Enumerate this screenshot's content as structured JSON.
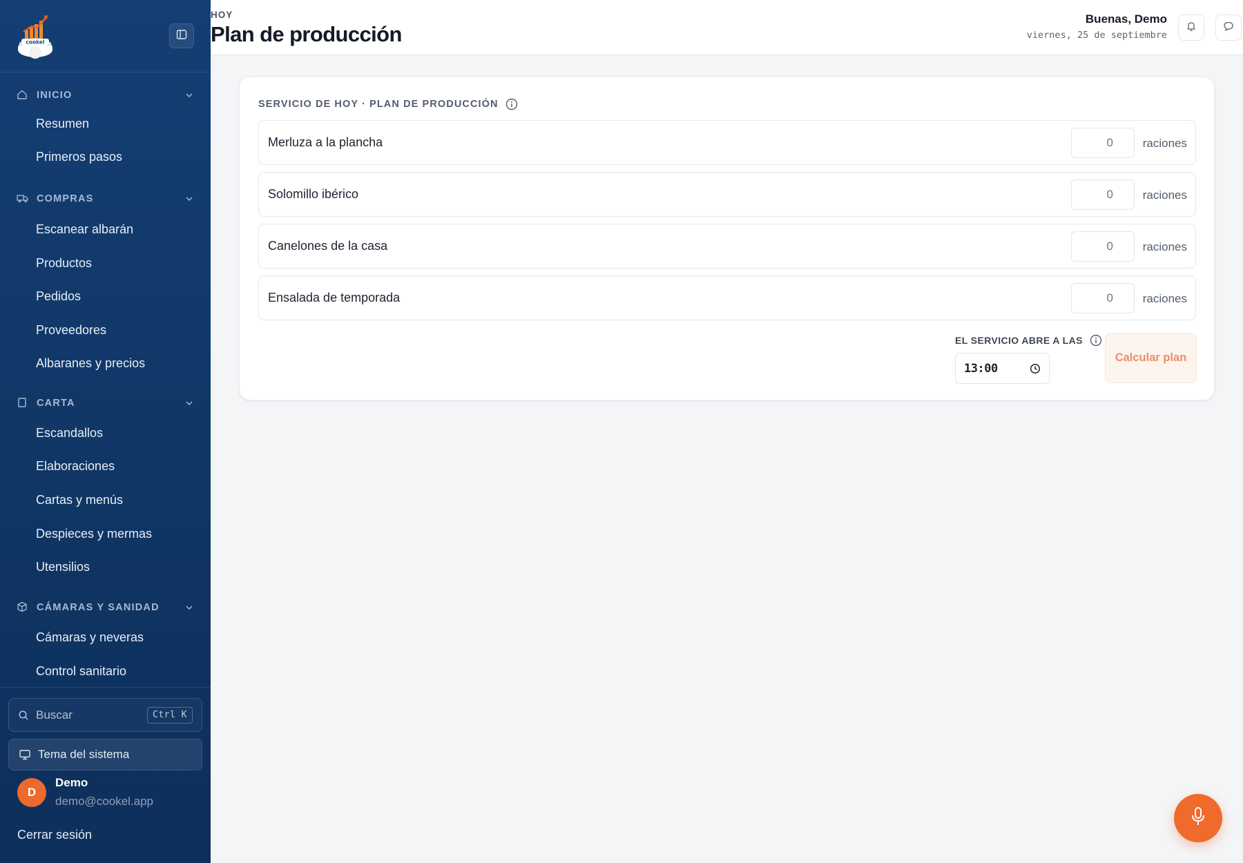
{
  "app": {
    "brand": "cookel"
  },
  "sidebar": {
    "sections": [
      {
        "label": "INICIO",
        "icon": "home-icon",
        "items": [
          "Resumen",
          "Primeros pasos"
        ]
      },
      {
        "label": "COMPRAS",
        "icon": "truck-icon",
        "items": [
          "Escanear albarán",
          "Productos",
          "Pedidos",
          "Proveedores",
          "Albaranes y precios"
        ]
      },
      {
        "label": "CARTA",
        "icon": "book-icon",
        "items": [
          "Escandallos",
          "Elaboraciones",
          "Cartas y menús",
          "Despieces y mermas",
          "Utensilios"
        ]
      },
      {
        "label": "CÁMARAS Y SANIDAD",
        "icon": "box-icon",
        "items": [
          "Cámaras y neveras",
          "Control sanitario"
        ]
      }
    ],
    "search": {
      "placeholder": "Buscar",
      "shortcut": "Ctrl K"
    },
    "theme_label": "Tema del sistema",
    "user": {
      "initial": "D",
      "name": "Demo",
      "email": "demo@cookel.app"
    },
    "logout_label": "Cerrar sesión"
  },
  "header": {
    "eyebrow": "HOY",
    "title": "Plan de producción",
    "greeting": "Buenas, Demo",
    "date": "viernes, 25 de septiembre"
  },
  "plan": {
    "title": "SERVICIO DE HOY · PLAN DE PRODUCCIÓN",
    "dishes": [
      {
        "name": "Merluza a la plancha",
        "placeholder": "0",
        "unit": "raciones"
      },
      {
        "name": "Solomillo ibérico",
        "placeholder": "0",
        "unit": "raciones"
      },
      {
        "name": "Canelones de la casa",
        "placeholder": "0",
        "unit": "raciones"
      },
      {
        "name": "Ensalada de temporada",
        "placeholder": "0",
        "unit": "raciones"
      }
    ],
    "open_label": "EL SERVICIO ABRE A LAS",
    "open_time": "13:00",
    "calculate_label": "Calcular plan"
  },
  "colors": {
    "sidebar": "#123b6e",
    "accent": "#ef6a2b",
    "button_disabled_bg": "#fdf4ee",
    "button_disabled_text": "#e8906a"
  }
}
